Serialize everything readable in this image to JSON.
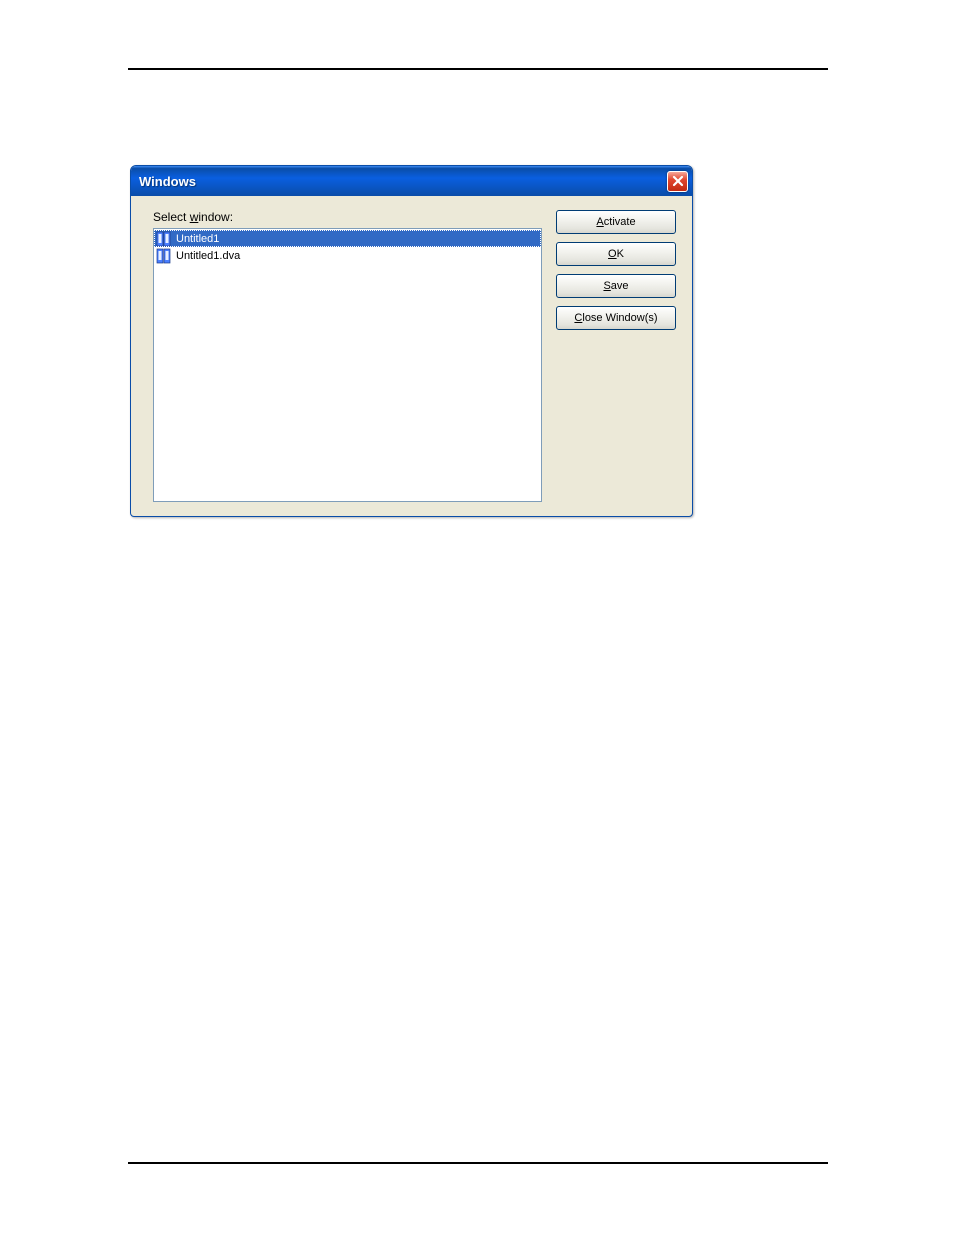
{
  "dialog": {
    "title": "Windows",
    "label_prefix": "Select ",
    "label_mnemonic": "w",
    "label_suffix": "indow:",
    "items": [
      {
        "name": "Untitled1",
        "selected": true
      },
      {
        "name": "Untitled1.dva",
        "selected": false
      }
    ],
    "buttons": {
      "activate": {
        "mnemonic": "A",
        "rest": "ctivate"
      },
      "ok": {
        "mnemonic": "O",
        "rest": "K"
      },
      "save": {
        "mnemonic": "S",
        "rest": "ave"
      },
      "close": {
        "mnemonic": "C",
        "rest": "lose Window(s)"
      }
    }
  }
}
